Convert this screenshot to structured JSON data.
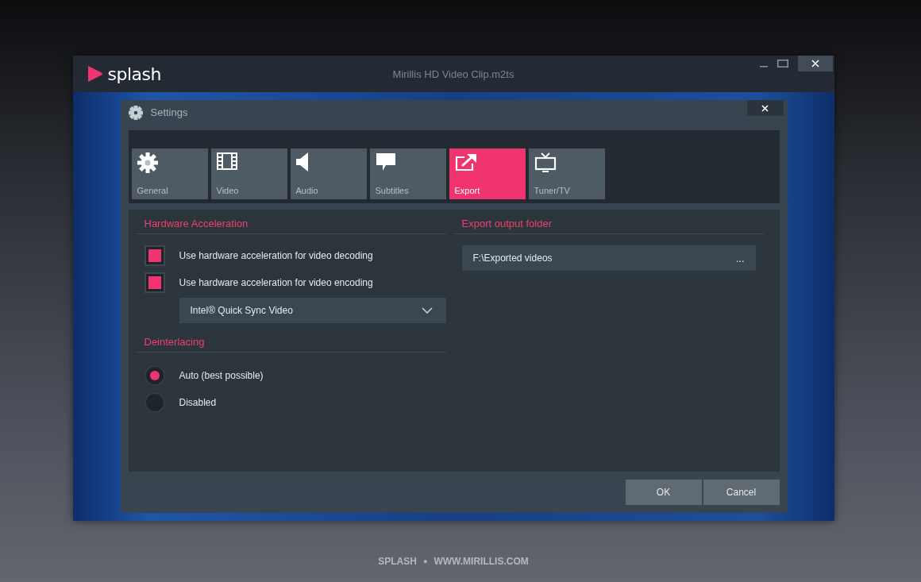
{
  "app": {
    "logo": "splash",
    "title": "Mirillis HD Video Clip.m2ts"
  },
  "dialog": {
    "title": "Settings",
    "tabs": [
      {
        "label": "General",
        "selected": false
      },
      {
        "label": "Video",
        "selected": false
      },
      {
        "label": "Audio",
        "selected": false
      },
      {
        "label": "Subtitles",
        "selected": false
      },
      {
        "label": "Export",
        "selected": true
      },
      {
        "label": "Tuner/TV",
        "selected": false
      }
    ],
    "hardware": {
      "heading": "Hardware Acceleration",
      "options": [
        {
          "label": "Use hardware acceleration for video decoding",
          "checked": true
        },
        {
          "label": "Use hardware acceleration for video encoding",
          "checked": true
        }
      ],
      "encoder": {
        "value": "Intel® Quick Sync Video"
      }
    },
    "deinterlacing": {
      "heading": "Deinterlacing",
      "options": [
        {
          "label": "Auto (best possible)",
          "selected": true
        },
        {
          "label": "Disabled",
          "selected": false
        }
      ]
    },
    "export": {
      "heading": "Export output folder",
      "folder": "F:\\Exported videos",
      "browse": "..."
    },
    "buttons": [
      "OK",
      "Cancel"
    ]
  },
  "footer": {
    "brand": "SPLASH",
    "separator": "●",
    "site": "WWW.MIRILLIS.COM"
  }
}
